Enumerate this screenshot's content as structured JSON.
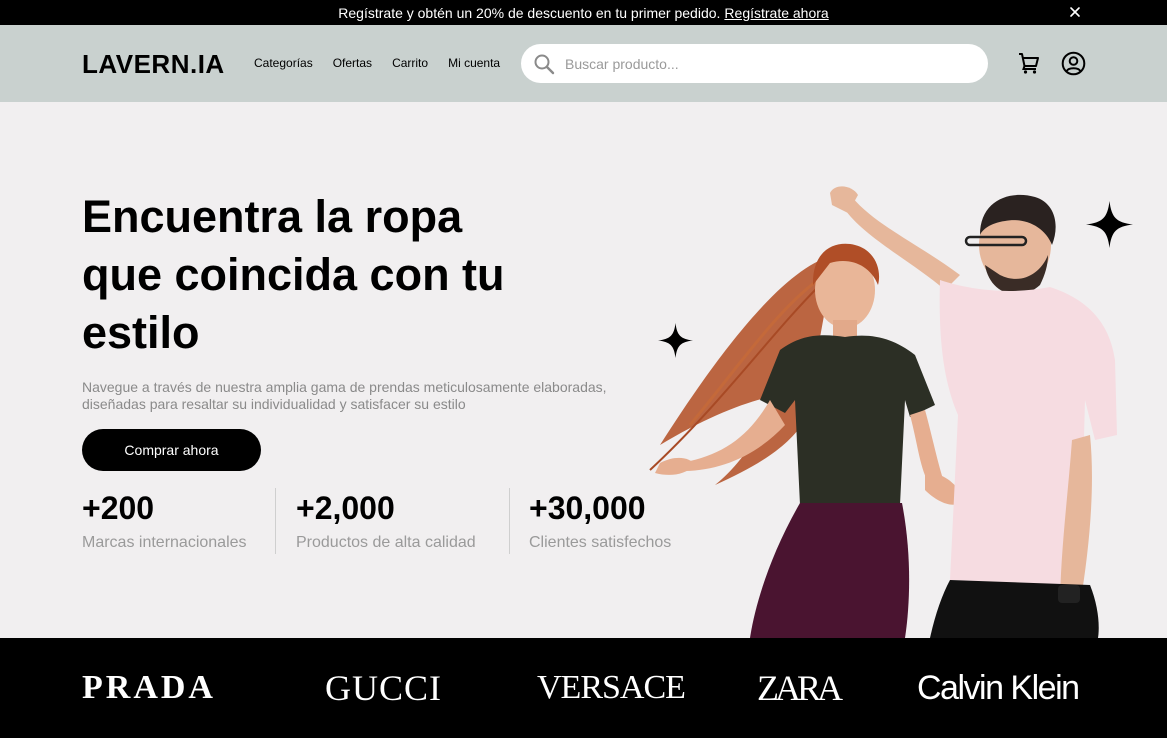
{
  "promo": {
    "text": "Regístrate y obtén un 20% de descuento en tu primer pedido.",
    "link": "Regístrate ahora"
  },
  "header": {
    "logo": "LAVERN.IA",
    "nav": [
      "Categorías",
      "Ofertas",
      "Carrito",
      "Mi cuenta"
    ],
    "search_placeholder": "Buscar producto...",
    "icons": [
      "search-icon",
      "cart-icon",
      "user-icon",
      "close-icon"
    ]
  },
  "hero": {
    "title": "Encuentra la ropa que coincida con tu estilo",
    "description": "Navegue a través de nuestra amplia gama de prendas meticulosamente elaboradas, diseñadas para resaltar su individualidad y satisfacer su estilo",
    "cta": "Comprar ahora",
    "stats": [
      {
        "value": "+200",
        "label": "Marcas internacionales"
      },
      {
        "value": "+2,000",
        "label": "Productos de alta calidad"
      },
      {
        "value": "+30,000",
        "label": "Clientes satisfechos"
      }
    ]
  },
  "brands": [
    "PRADA",
    "GUCCI",
    "VERSACE",
    "ZARA",
    "Calvin Klein"
  ],
  "colors": {
    "background": "#f1eff0",
    "navbar": "#c9d1cf",
    "promo_bar": "#000000",
    "brands_bar": "#000000",
    "cta": "#000000"
  }
}
